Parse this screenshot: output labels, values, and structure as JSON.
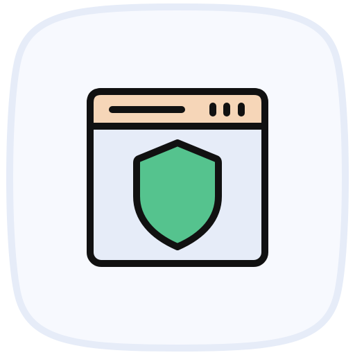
{
  "icon": {
    "name": "browser-shield-icon",
    "description_semantic": "browser-window-security",
    "parts": {
      "tile": "app-tile",
      "window": "browser-window",
      "titlebar": "browser-titlebar",
      "address_bar": "address-bar",
      "window_controls": [
        "window-control-dot",
        "window-control-dot",
        "window-control-dot"
      ],
      "shield": "shield-icon"
    }
  },
  "colors": {
    "tile_border": "#E6ECF8",
    "tile_fill": "#F7F9FE",
    "window_fill": "#E6ECF8",
    "titlebar_fill": "#F6D6B8",
    "stroke": "#111111",
    "shield_fill": "#55C38E"
  }
}
